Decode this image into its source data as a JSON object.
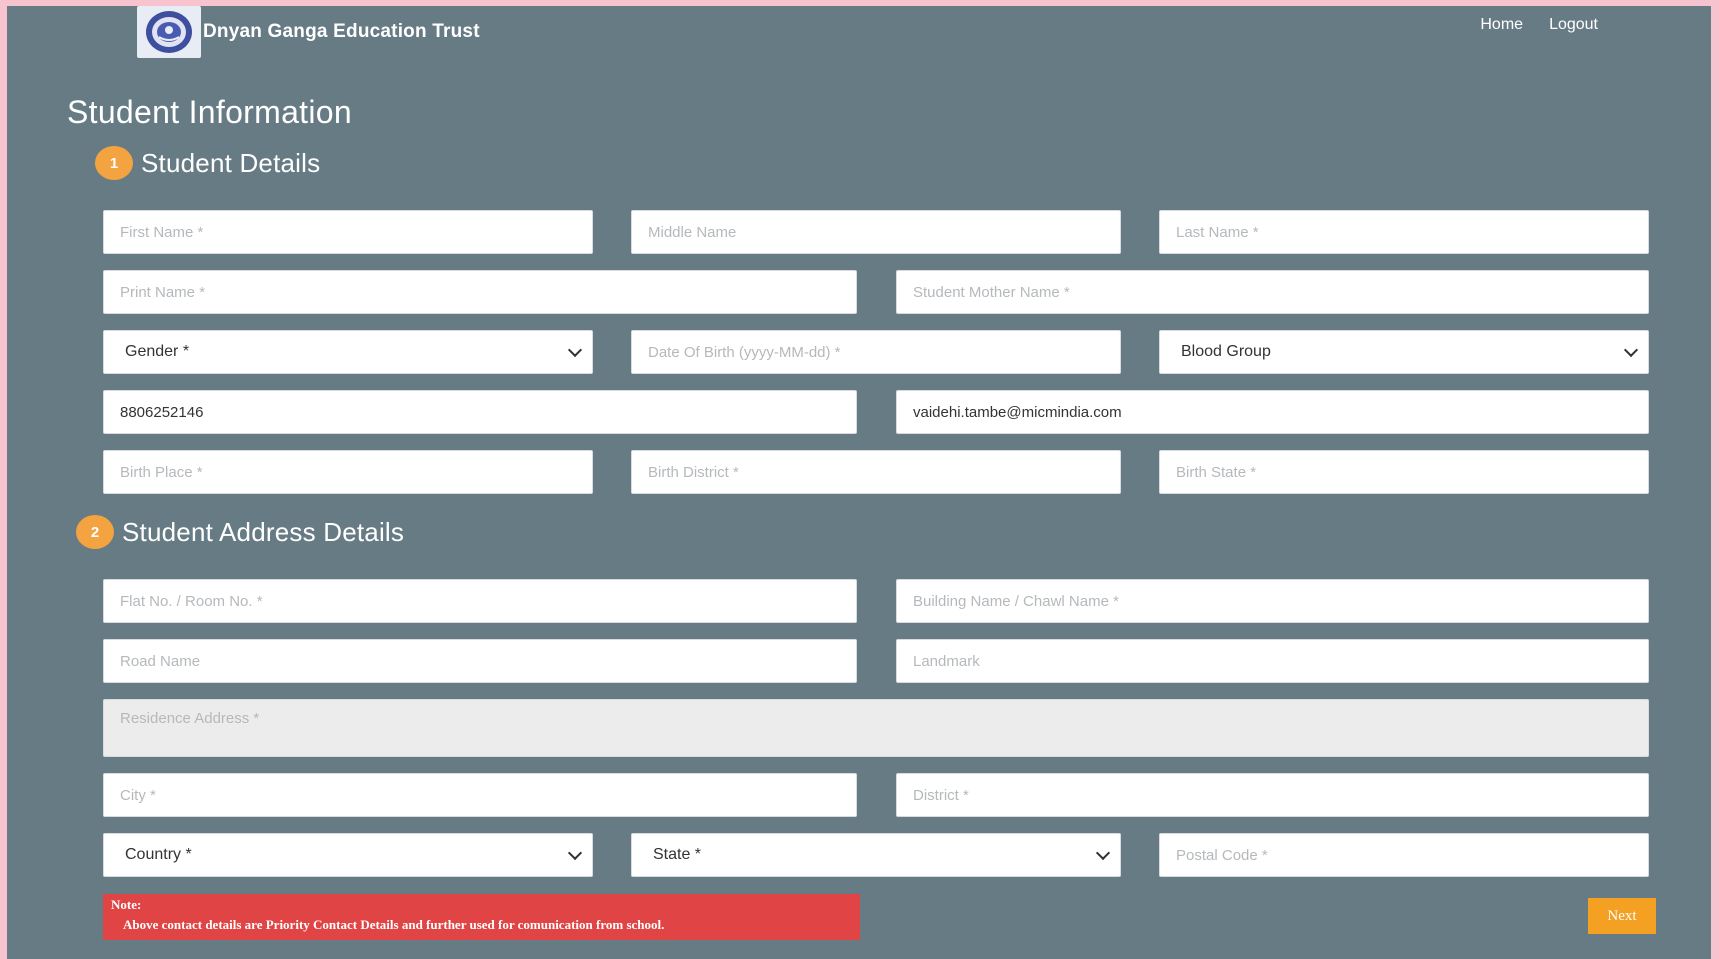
{
  "header": {
    "brand_name": "Dnyan Ganga Education Trust",
    "nav": {
      "home": "Home",
      "logout": "Logout"
    }
  },
  "page_title": "Student Information",
  "colors": {
    "background": "#677b85",
    "accent": "#f3a441",
    "note": "#e04444",
    "next_button": "#f3a023"
  },
  "student_details": {
    "step": "1",
    "title": "Student Details",
    "first_name": {
      "placeholder": "First Name *",
      "value": ""
    },
    "middle_name": {
      "placeholder": "Middle Name",
      "value": ""
    },
    "last_name": {
      "placeholder": "Last Name *",
      "value": ""
    },
    "print_name": {
      "placeholder": "Print Name *",
      "value": ""
    },
    "mother_name": {
      "placeholder": "Student Mother Name *",
      "value": ""
    },
    "gender": {
      "selected": "Gender *"
    },
    "dob": {
      "placeholder": "Date Of Birth (yyyy-MM-dd) *",
      "value": ""
    },
    "blood_group": {
      "selected": "Blood Group"
    },
    "phone": {
      "value": "8806252146"
    },
    "email": {
      "value": "vaidehi.tambe@micmindia.com"
    },
    "birth_place": {
      "placeholder": "Birth Place *",
      "value": ""
    },
    "birth_district": {
      "placeholder": "Birth District *",
      "value": ""
    },
    "birth_state": {
      "placeholder": "Birth State *",
      "value": ""
    }
  },
  "address_details": {
    "step": "2",
    "title": "Student Address Details",
    "flat_no": {
      "placeholder": "Flat No. / Room No. *",
      "value": ""
    },
    "building": {
      "placeholder": "Building Name / Chawl Name *",
      "value": ""
    },
    "road": {
      "placeholder": "Road Name",
      "value": ""
    },
    "landmark": {
      "placeholder": "Landmark",
      "value": ""
    },
    "residence_address": {
      "placeholder": "Residence Address *",
      "value": ""
    },
    "city": {
      "placeholder": "City *",
      "value": ""
    },
    "district": {
      "placeholder": "District *",
      "value": ""
    },
    "country": {
      "selected": "Country *"
    },
    "state": {
      "selected": "State *"
    },
    "postal_code": {
      "placeholder": "Postal Code *",
      "value": ""
    }
  },
  "note": {
    "label": "Note:",
    "text": "Above contact details are Priority Contact Details and further used for comunication from school."
  },
  "next_button": "Next"
}
